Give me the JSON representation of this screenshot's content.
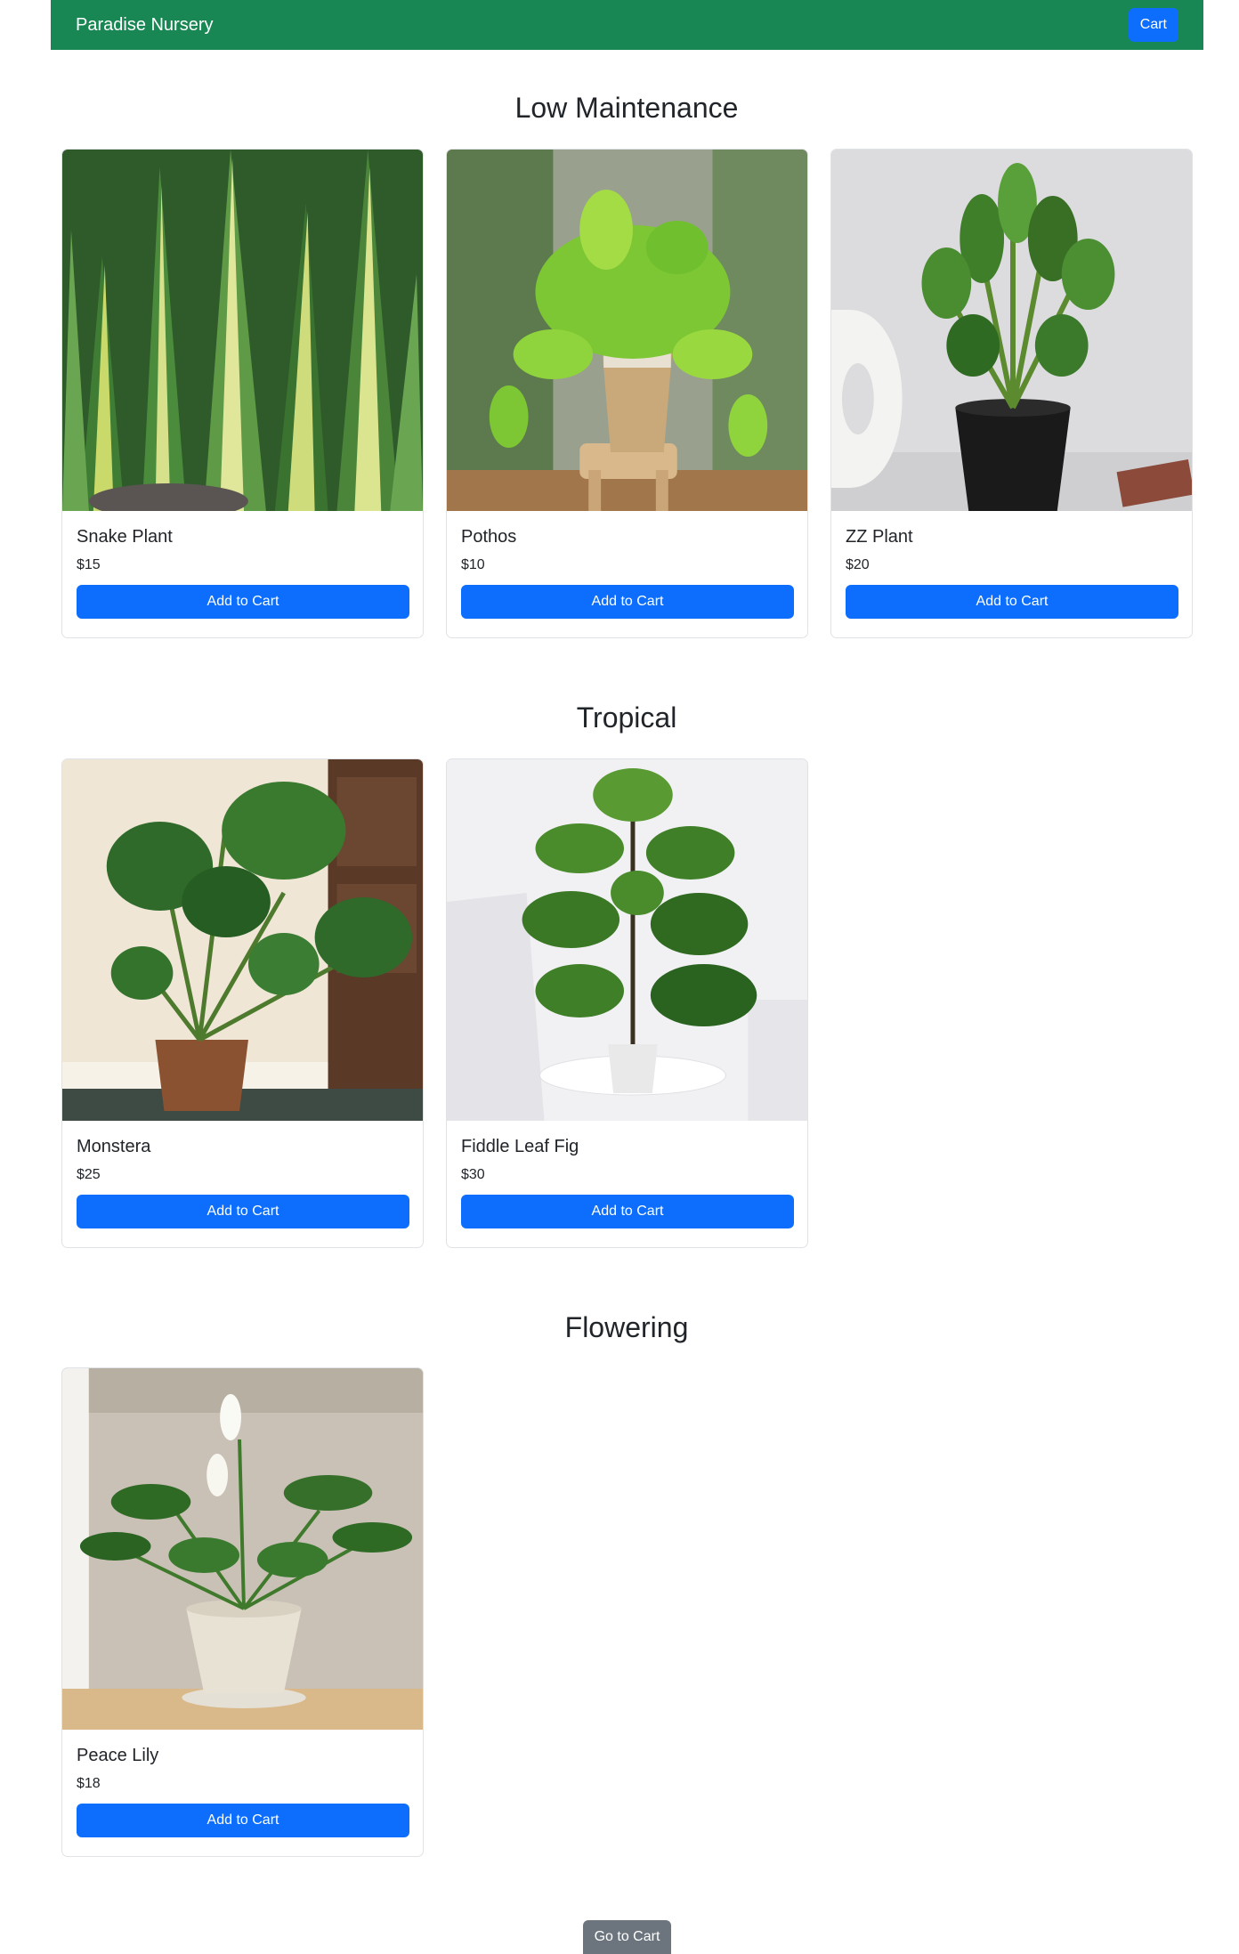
{
  "navbar": {
    "brand": "Paradise Nursery",
    "cart_label": "Cart"
  },
  "sections": [
    {
      "title": "Low Maintenance",
      "plants": [
        {
          "name": "Snake Plant",
          "price": "$15",
          "button": "Add to Cart",
          "image": "snake-plant-photo"
        },
        {
          "name": "Pothos",
          "price": "$10",
          "button": "Add to Cart",
          "image": "pothos-photo"
        },
        {
          "name": "ZZ Plant",
          "price": "$20",
          "button": "Add to Cart",
          "image": "zz-plant-photo"
        }
      ]
    },
    {
      "title": "Tropical",
      "plants": [
        {
          "name": "Monstera",
          "price": "$25",
          "button": "Add to Cart",
          "image": "monstera-photo"
        },
        {
          "name": "Fiddle Leaf Fig",
          "price": "$30",
          "button": "Add to Cart",
          "image": "fiddle-leaf-fig-photo"
        }
      ]
    },
    {
      "title": "Flowering",
      "plants": [
        {
          "name": "Peace Lily",
          "price": "$18",
          "button": "Add to Cart",
          "image": "peace-lily-photo"
        }
      ]
    }
  ],
  "footer": {
    "go_to_cart": "Go to Cart"
  },
  "colors": {
    "navbar": "#198754",
    "primary": "#0d6efd",
    "secondary": "#6c757d"
  }
}
